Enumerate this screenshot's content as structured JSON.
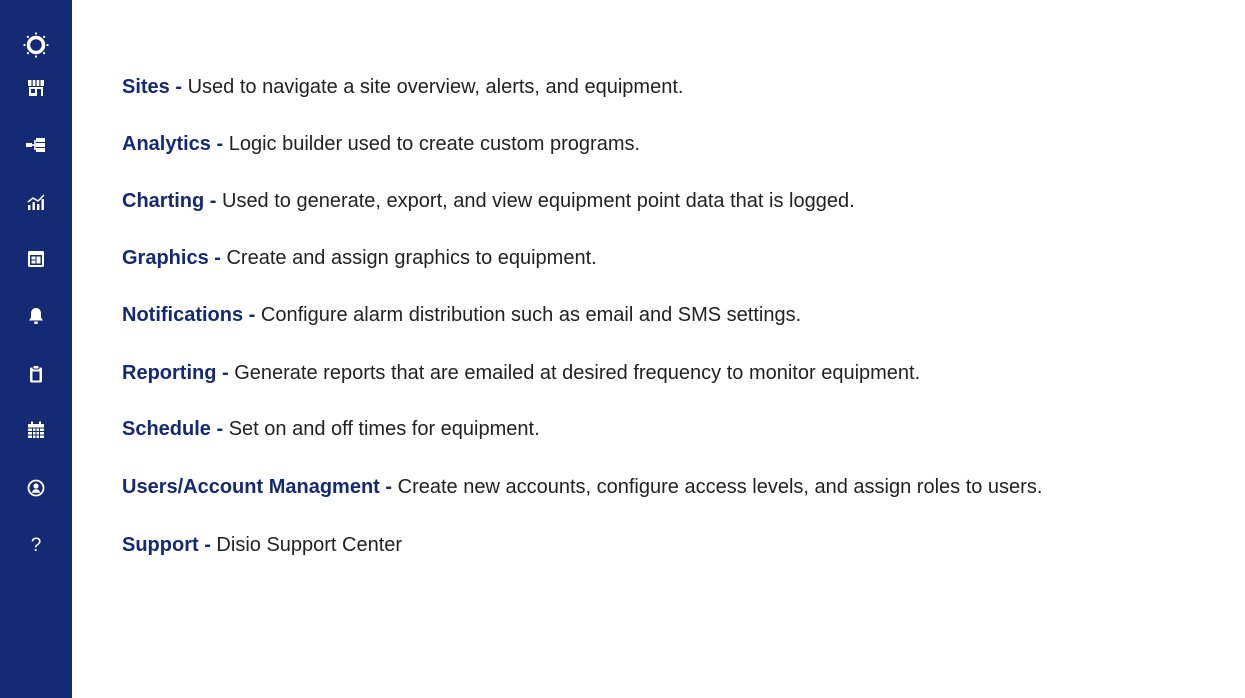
{
  "sidebar": {
    "logo_icon": "sun-ring-logo-icon",
    "background": "#142a73",
    "items": [
      {
        "icon": "storefront-icon"
      },
      {
        "icon": "analytics-flow-icon"
      },
      {
        "icon": "chart-bars-icon"
      },
      {
        "icon": "graphics-window-icon"
      },
      {
        "icon": "bell-icon"
      },
      {
        "icon": "clipboard-icon"
      },
      {
        "icon": "calendar-icon"
      },
      {
        "icon": "user-circle-icon"
      },
      {
        "icon": "question-mark-icon",
        "glyph": "?"
      }
    ]
  },
  "legend": {
    "accent_color": "#142a73",
    "items": [
      {
        "name": "Sites -",
        "description": " Used to navigate a site overview, alerts, and equipment."
      },
      {
        "name": "Analytics -",
        "description": " Logic builder used to create custom programs."
      },
      {
        "name": "Charting -",
        "description": " Used to generate, export, and view equipment point data that is logged."
      },
      {
        "name": "Graphics -",
        "description": " Create and assign graphics to equipment."
      },
      {
        "name": "Notifications -",
        "description": " Configure alarm distribution such as email and SMS settings."
      },
      {
        "name": "Reporting -",
        "description": " Generate reports that are emailed at desired frequency to monitor equipment."
      },
      {
        "name": "Schedule -",
        "description": " Set on and off times for equipment."
      },
      {
        "name": "Users/Account Managment -",
        "description": " Create new accounts, configure access levels, and assign roles to users."
      },
      {
        "name": "Support -",
        "description": " Disio Support Center"
      }
    ]
  }
}
